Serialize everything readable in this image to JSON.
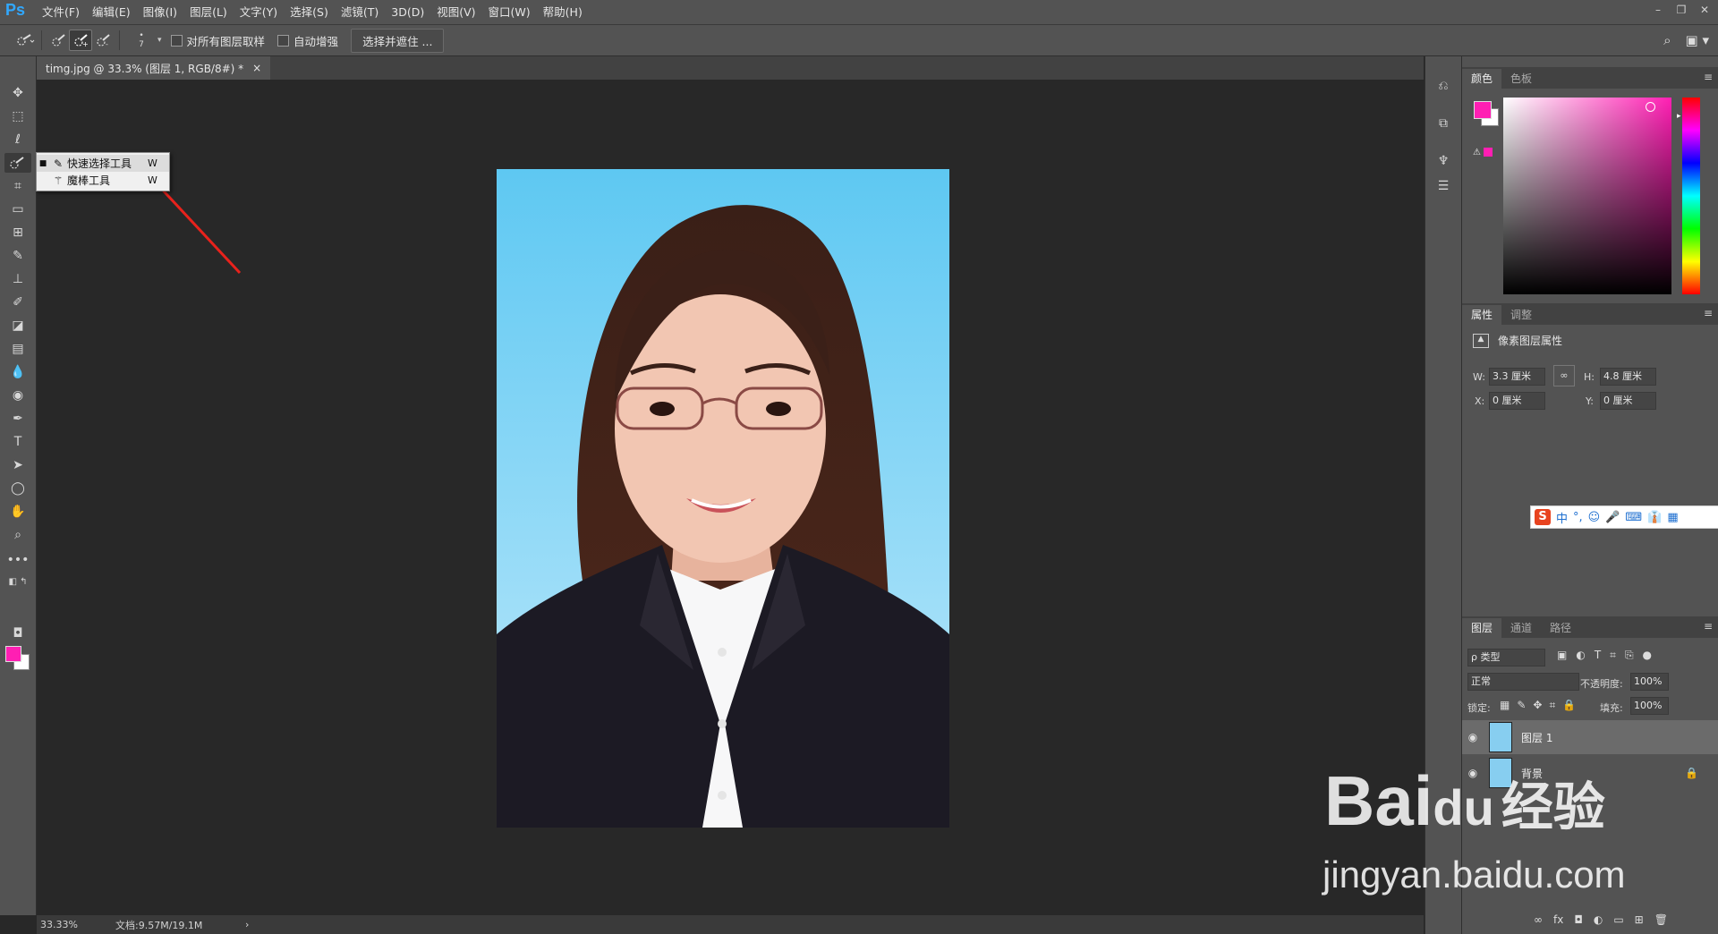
{
  "app": {
    "logo": "Ps"
  },
  "menu": [
    "文件(F)",
    "编辑(E)",
    "图像(I)",
    "图层(L)",
    "文字(Y)",
    "选择(S)",
    "滤镜(T)",
    "3D(D)",
    "视图(V)",
    "窗口(W)",
    "帮助(H)"
  ],
  "window_controls": {
    "minimize": "–",
    "restore": "❐",
    "close": "✕"
  },
  "options": {
    "brush_size": "7",
    "sample_all_layers": "对所有图层取样",
    "auto_enhance": "自动增强",
    "select_and_mask": "选择并遮住 ..."
  },
  "document": {
    "tab_title": "timg.jpg @ 33.3% (图层 1, RGB/8#) *",
    "close": "×"
  },
  "flyout": {
    "items": [
      {
        "label": "快速选择工具",
        "key": "W",
        "icon": "quick-selection-icon"
      },
      {
        "label": "魔棒工具",
        "key": "W",
        "icon": "magic-wand-icon"
      }
    ]
  },
  "status": {
    "zoom": "33.33%",
    "doc": "文档:9.57M/19.1M",
    "arrow": "›"
  },
  "color_panel": {
    "tabs": [
      "颜色",
      "色板"
    ],
    "foreground": "#ff1fb3",
    "background": "#ffffff"
  },
  "properties_panel": {
    "tabs": [
      "属性",
      "调整"
    ],
    "title": "像素图层属性",
    "w_label": "W:",
    "w_value": "3.3 厘米",
    "h_label": "H:",
    "h_value": "4.8 厘米",
    "x_label": "X:",
    "x_value": "0 厘米",
    "y_label": "Y:",
    "y_value": "0 厘米"
  },
  "layers_panel": {
    "tabs": [
      "图层",
      "通道",
      "路径"
    ],
    "filter": "ρ 类型",
    "blend_mode": "正常",
    "opacity_label": "不透明度:",
    "opacity": "100%",
    "lock_label": "锁定:",
    "fill_label": "填充:",
    "fill": "100%",
    "layers": [
      {
        "name": "图层 1",
        "visible": true,
        "selected": true
      },
      {
        "name": "背景",
        "visible": true,
        "locked": true
      }
    ]
  },
  "ime": {
    "brand": "S",
    "items": [
      "中",
      "°,",
      "☺",
      "🎤",
      "⌨",
      "👔",
      "▦"
    ]
  },
  "watermark": {
    "brand": "Bai",
    "du": "du",
    "jy": "经验",
    "url": "jingyan.baidu.com"
  },
  "colors": {
    "accent": "#31a8ff",
    "arrow": "#e8221c",
    "photo_bg_top": "#5ec8f2",
    "photo_bg_bottom": "#bfe9fb",
    "suit": "#1c1a24"
  }
}
